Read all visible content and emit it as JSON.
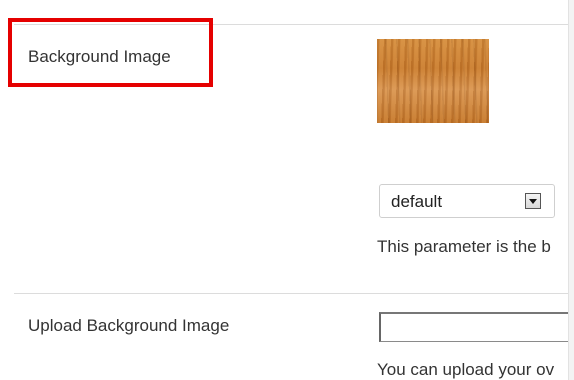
{
  "background_image": {
    "label": "Background Image",
    "thumbnail": "wood-texture-thumbnail",
    "select_value": "default",
    "help_text": "This parameter is the b"
  },
  "upload_background_image": {
    "label": "Upload Background Image",
    "input_value": "",
    "help_text": "You can upload your ov"
  },
  "colors": {
    "highlight": "#e50000"
  }
}
